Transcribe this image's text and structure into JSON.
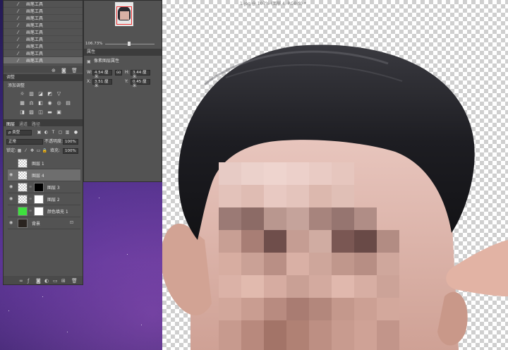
{
  "canvas": {
    "doc_title": "1.jpg @ 107% (图层 4, RGB/8) *"
  },
  "history": {
    "items": [
      {
        "label": "画笔工具"
      },
      {
        "label": "画笔工具"
      },
      {
        "label": "画笔工具"
      },
      {
        "label": "画笔工具"
      },
      {
        "label": "画笔工具"
      },
      {
        "label": "画笔工具"
      },
      {
        "label": "画笔工具"
      },
      {
        "label": "画笔工具"
      },
      {
        "label": "画笔工具"
      }
    ]
  },
  "navigator": {
    "zoom": "106.73%"
  },
  "properties": {
    "tab": "属性",
    "title": "像素图层属性",
    "w_label": "W:",
    "w_value": "4.54 厘米",
    "go_label": "GO",
    "h_label": "H:",
    "h_value": "3.44 厘米",
    "x_label": "X:",
    "x_value": "3.51 厘米",
    "y_label": "Y:",
    "y_value": "0.45 厘米"
  },
  "adjustments": {
    "tab": "调整",
    "add_label": "添加调整"
  },
  "layers_panel": {
    "tabs": [
      "图层",
      "通道",
      "路径"
    ],
    "filter_label": "ρ 类型",
    "blend_mode": "正常",
    "opacity_label": "不透明度:",
    "opacity_value": "100%",
    "lock_label": "锁定:",
    "fill_label": "填充:",
    "fill_value": "100%",
    "layers": [
      {
        "name": "图层 1"
      },
      {
        "name": "图层 4"
      },
      {
        "name": "图层 3"
      },
      {
        "name": "图层 2"
      },
      {
        "name": "颜色填充 1"
      },
      {
        "name": "背景"
      }
    ]
  }
}
